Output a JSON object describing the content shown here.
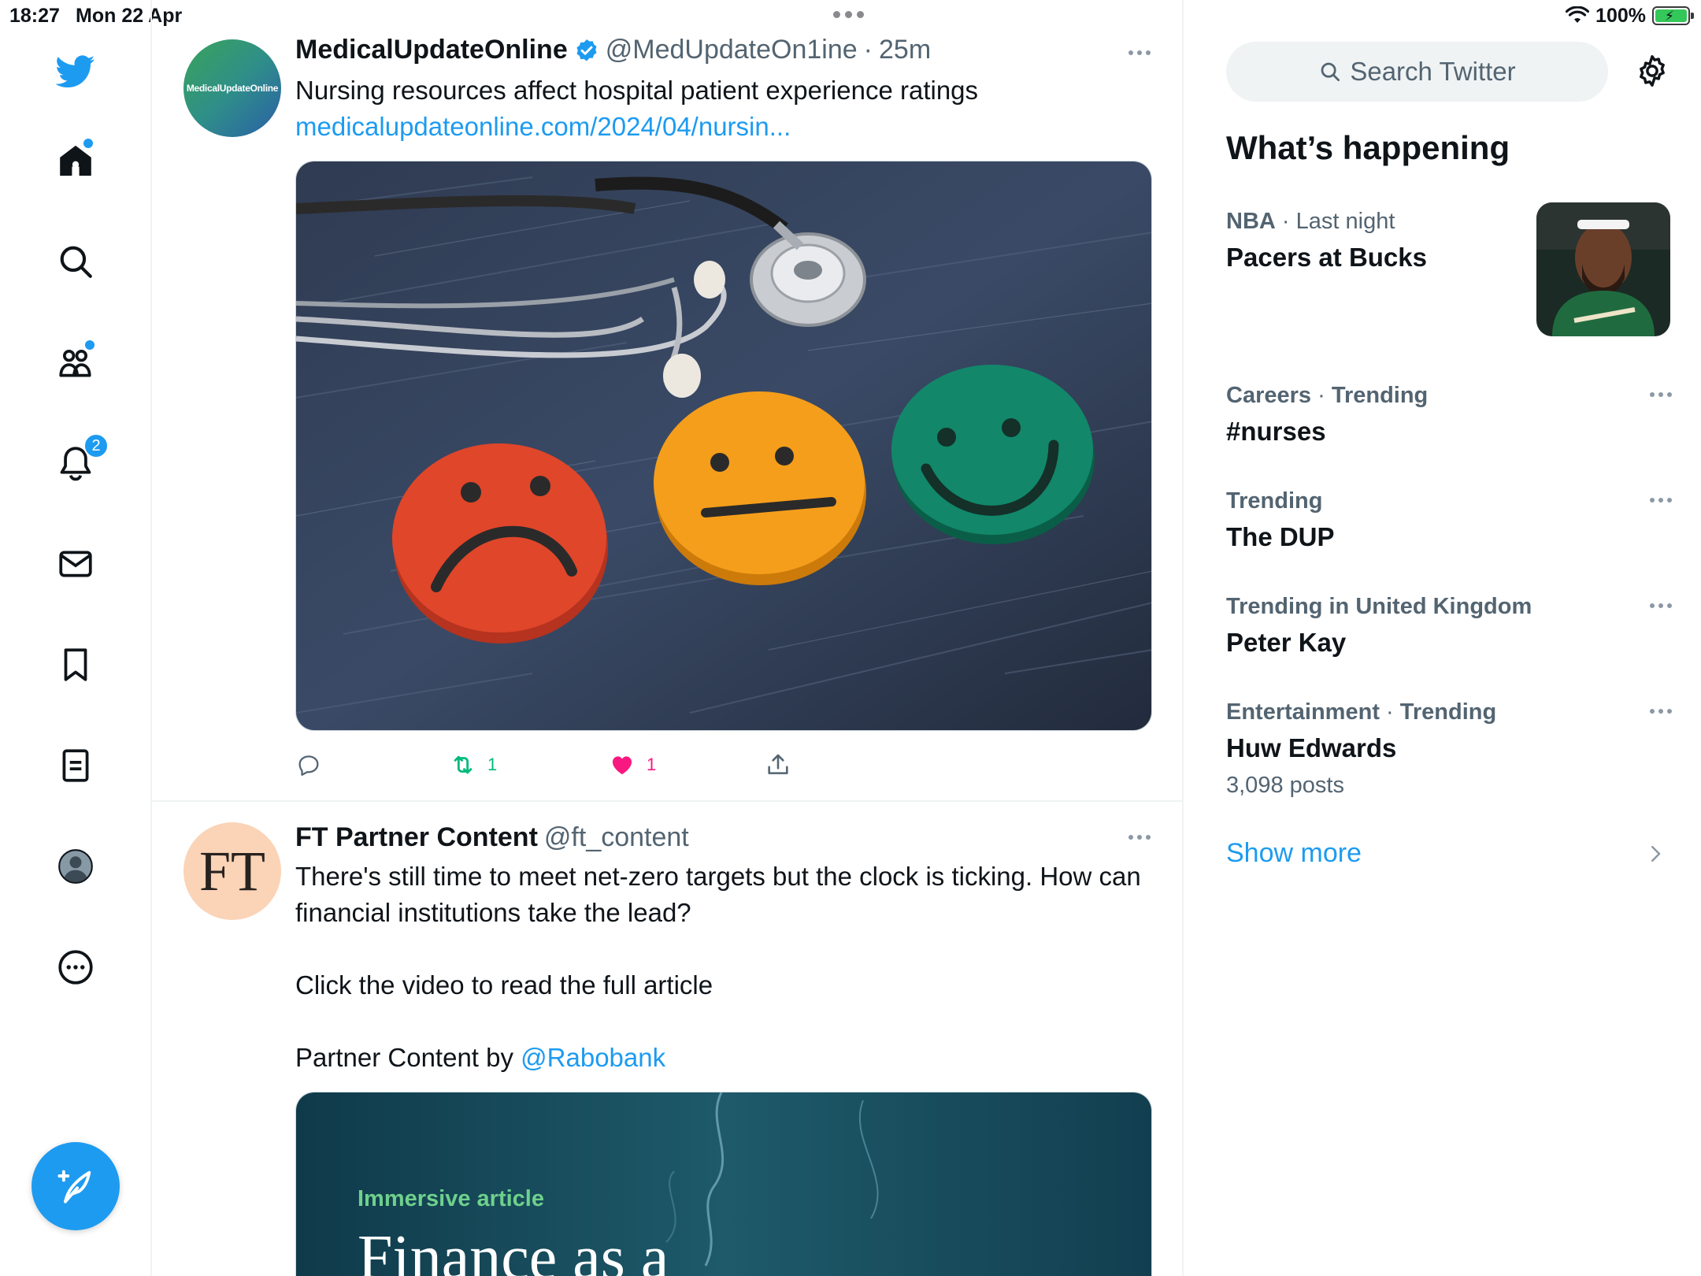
{
  "status_bar": {
    "time": "18:27",
    "date": "Mon 22 Apr",
    "battery": "100%"
  },
  "nav": {
    "icons": [
      "twitter-logo-icon",
      "home-icon",
      "search-icon",
      "communities-icon",
      "notifications-icon",
      "messages-icon",
      "bookmarks-icon",
      "lists-icon",
      "profile-icon",
      "more-icon",
      "compose-icon"
    ],
    "notifications_badge": "2"
  },
  "tweets": [
    {
      "avatar_text": "MedicalUpdateOnline",
      "display_name": "MedicalUpdateOnline",
      "handle": "@MedUpdateOn1ine",
      "separator": "·",
      "time": "25m",
      "text": "Nursing resources affect hospital patient experience ratings",
      "link": "medicalupdateonline.com/2024/04/nursin...",
      "media_description": "stethoscope-with-sad-neutral-happy-faces",
      "retweets": "1",
      "likes": "1"
    },
    {
      "avatar_text": "FT",
      "display_name": "FT Partner Content",
      "handle": "@ft_content",
      "text_line1": "There's still time to meet net-zero targets but the clock is ticking. How can financial institutions take the lead?",
      "text_line2": "Click the video to read the full article",
      "text_line3_prefix": "Partner Content by ",
      "text_line3_mention": "@Rabobank",
      "media_label": "Immersive article",
      "media_headline": "Finance as a"
    }
  ],
  "sidebar": {
    "search_placeholder": "Search Twitter",
    "section_title": "What’s happening",
    "trends": [
      {
        "category": "NBA",
        "separator": "·",
        "context": "Last night",
        "title": "Pacers at Bucks",
        "has_image": true
      },
      {
        "category": "Careers",
        "separator": "·",
        "context": "Trending",
        "title": "#nurses"
      },
      {
        "category": "Trending",
        "title": "The DUP"
      },
      {
        "category": "Trending in United Kingdom",
        "title": "Peter Kay"
      },
      {
        "category": "Entertainment",
        "separator": "·",
        "context": "Trending",
        "title": "Huw Edwards",
        "count": "3,098 posts"
      }
    ],
    "show_more": "Show more"
  },
  "colors": {
    "accent": "#1d9bf0",
    "like": "#f91880",
    "retweet": "#00ba7c",
    "secondary_text": "#536471"
  }
}
